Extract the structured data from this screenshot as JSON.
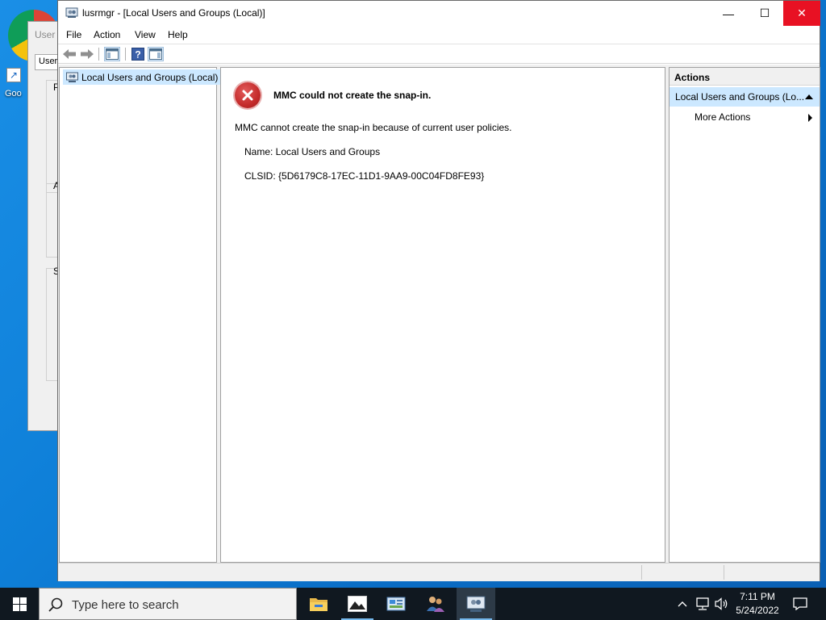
{
  "window": {
    "title": "lusrmgr - [Local Users and Groups (Local)]",
    "minimize_glyph": "—",
    "maximize_glyph": "☐",
    "close_glyph": "✕"
  },
  "menu": [
    "File",
    "Action",
    "View",
    "Help"
  ],
  "tree": {
    "root_label": "Local Users and Groups (Local)"
  },
  "error": {
    "title": "MMC could not create the snap-in.",
    "body": "MMC cannot create the snap-in because of current user policies.",
    "name_line": "Name: Local Users and Groups",
    "clsid_line": "CLSID: {5D6179C8-17EC-11D1-9AA9-00C04FD8FE93}"
  },
  "actions": {
    "header": "Actions",
    "group_label": "Local Users and Groups (Lo...",
    "more_actions": "More Actions"
  },
  "background_window": {
    "title": "User A",
    "tab": "Users",
    "letters": [
      "P",
      "A",
      "S"
    ]
  },
  "desktop_icon": {
    "label": "Goo"
  },
  "taskbar": {
    "search_placeholder": "Type here to search",
    "apps": [
      "file-explorer-icon",
      "photos-icon",
      "control-panel-icon",
      "users-icon",
      "mmc-icon"
    ],
    "time": "7:11 PM",
    "date": "5/24/2022"
  },
  "colors": {
    "close_red": "#e81123",
    "selection_blue": "#cce8ff",
    "taskbar_bg": "#101820",
    "desktop_blue": "#0e7fd8"
  }
}
